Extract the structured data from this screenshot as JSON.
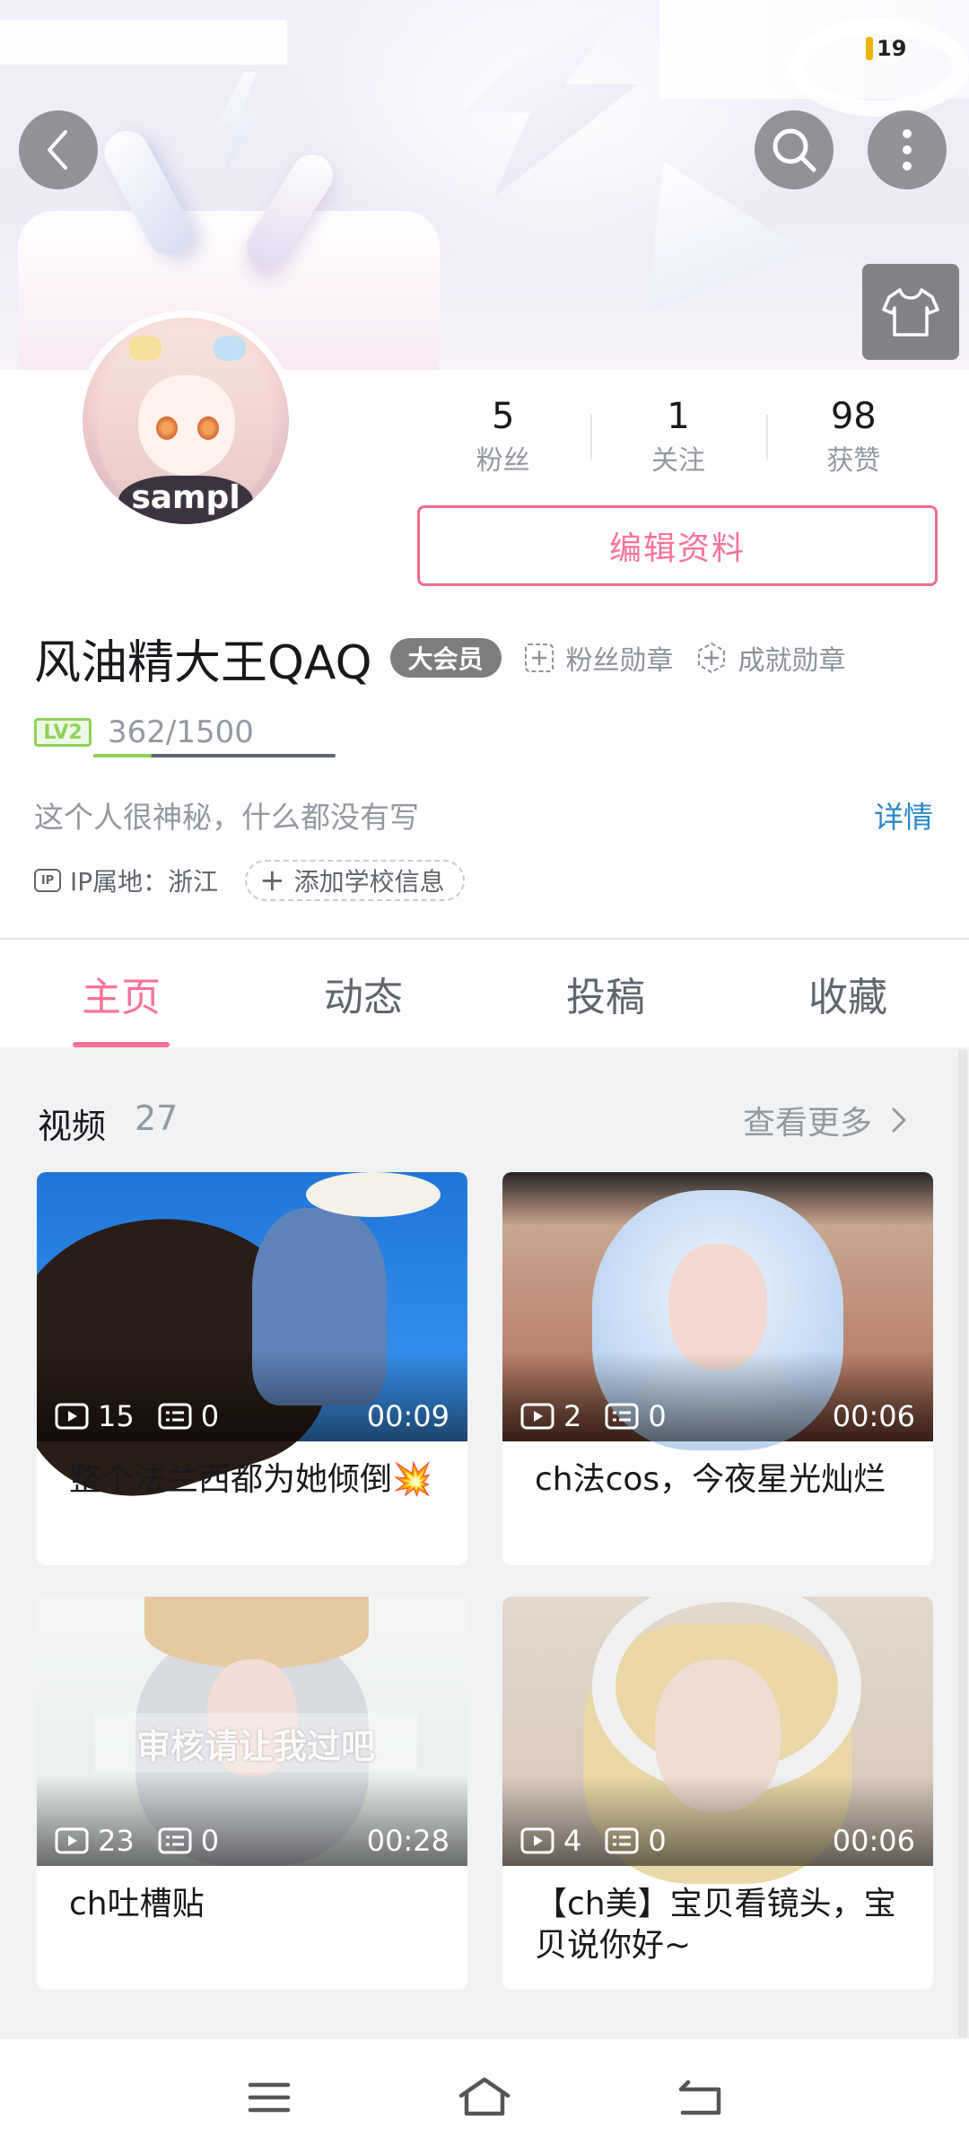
{
  "status": {
    "battery": "19"
  },
  "profile": {
    "avatar_watermark": "sampl",
    "username": "风油精大王QAQ",
    "vip_badge": "大会员",
    "fan_medal": "粉丝勋章",
    "achievement_medal": "成就勋章",
    "level_badge": "LV2",
    "exp": "362/1500",
    "exp_progress": 0.2413,
    "signature": "这个人很神秘，什么都没有写",
    "detail_link": "详情",
    "ip_icon": "IP",
    "ip_location": "IP属地：浙江",
    "add_school": "添加学校信息",
    "edit_button": "编辑资料"
  },
  "stats": [
    {
      "value": "5",
      "label": "粉丝"
    },
    {
      "value": "1",
      "label": "关注"
    },
    {
      "value": "98",
      "label": "获赞"
    }
  ],
  "tabs": [
    {
      "label": "主页",
      "active": true
    },
    {
      "label": "动态",
      "active": false
    },
    {
      "label": "投稿",
      "active": false
    },
    {
      "label": "收藏",
      "active": false
    }
  ],
  "videos_section": {
    "title": "视频",
    "count": "27",
    "see_more": "查看更多"
  },
  "videos": [
    {
      "plays": "15",
      "danmaku": "0",
      "duration": "00:09",
      "title": "整个法兰西都为她倾倒💥"
    },
    {
      "plays": "2",
      "danmaku": "0",
      "duration": "00:06",
      "title": "ch法cos，今夜星光灿烂"
    },
    {
      "plays": "23",
      "danmaku": "0",
      "duration": "00:28",
      "title": "ch吐槽贴",
      "thumb_text": "审核请让我过吧"
    },
    {
      "plays": "4",
      "danmaku": "0",
      "duration": "00:06",
      "title": "【ch美】宝贝看镜头，宝贝说你好~"
    }
  ],
  "icons": {
    "back": "chevron-left-icon",
    "search": "search-icon",
    "more": "more-vertical-icon",
    "skin": "tshirt-icon",
    "menu": "menu-icon",
    "home": "home-icon",
    "back_nav": "back-nav-icon"
  },
  "colors": {
    "accent": "#fb7299",
    "link": "#2b88c9",
    "level": "#8ed25a",
    "battery": "#f0b400"
  }
}
